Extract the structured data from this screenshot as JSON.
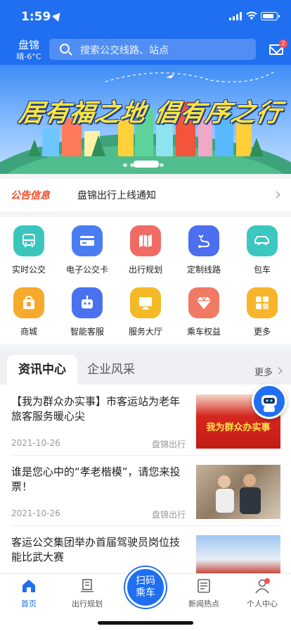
{
  "status_bar": {
    "time": "1:59"
  },
  "header": {
    "city": "盘锦",
    "weather": "晴-6°C",
    "search_placeholder": "搜索公交线路、站点",
    "mail_badge": "2"
  },
  "banner": {
    "slogan": "居有福之地 倡有序之行"
  },
  "notice": {
    "tag": "公告信息",
    "text": "盘锦出行上线通知"
  },
  "services": [
    {
      "label": "实时公交",
      "icon": "bus-icon",
      "color": "#3bc6bd"
    },
    {
      "label": "电子公交卡",
      "icon": "card-icon",
      "color": "#4a7df2"
    },
    {
      "label": "出行规划",
      "icon": "map-icon",
      "color": "#f06b63"
    },
    {
      "label": "定制线路",
      "icon": "route-icon",
      "color": "#4c6ff0"
    },
    {
      "label": "包车",
      "icon": "car-icon",
      "color": "#3cc7c0"
    },
    {
      "label": "商城",
      "icon": "shopping-bag-icon",
      "color": "#f6a92b"
    },
    {
      "label": "智能客服",
      "icon": "robot-icon",
      "color": "#4a72ef"
    },
    {
      "label": "服务大厅",
      "icon": "monitor-icon",
      "color": "#f4b926"
    },
    {
      "label": "乘车权益",
      "icon": "diamond-icon",
      "color": "#f07a63"
    },
    {
      "label": "更多",
      "icon": "grid-icon",
      "color": "#f7b52b"
    }
  ],
  "news": {
    "tabs": [
      "资讯中心",
      "企业风采"
    ],
    "more": "更多",
    "articles": [
      {
        "title": "【我为群众办实事】市客运站为老年旅客服务暖心尖",
        "date": "2021-10-26",
        "source": "盘锦出行",
        "thumb_text": "我为群众办实事"
      },
      {
        "title": "谁是您心中的“孝老楷模”，请您来投票！",
        "date": "2021-10-26",
        "source": "盘锦出行"
      },
      {
        "title": "客运公交集团举办首届驾驶员岗位技能比武大赛",
        "date": "",
        "source": ""
      }
    ]
  },
  "tabbar": {
    "items": [
      "首页",
      "出行规划",
      "新闻热点",
      "个人中心"
    ],
    "scan": [
      "扫码",
      "乘车"
    ]
  },
  "colors": {
    "primary": "#1f6ff0",
    "notice_tag": "#ee4d27"
  }
}
